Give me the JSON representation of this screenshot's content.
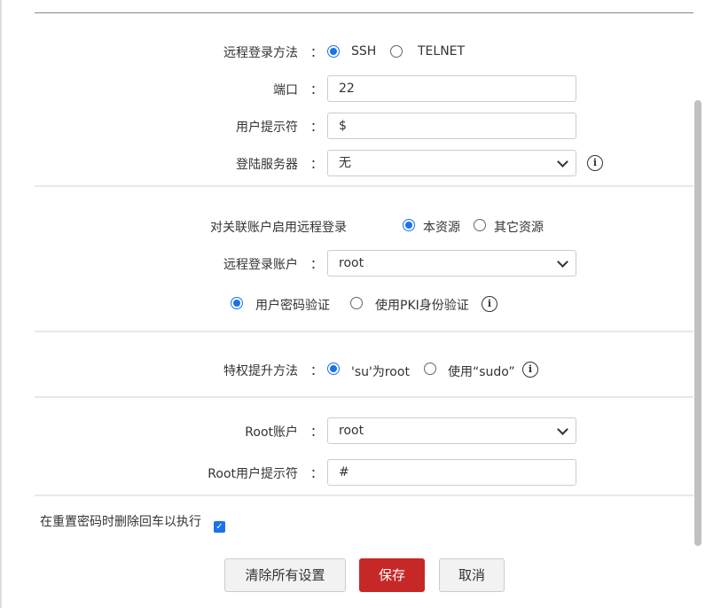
{
  "login_method": {
    "label": "远程登录方法",
    "options": [
      "SSH",
      "TELNET"
    ],
    "selected": "SSH"
  },
  "port": {
    "label": "端口",
    "value": "22"
  },
  "user_prompt": {
    "label": "用户提示符",
    "value": "$"
  },
  "login_server": {
    "label": "登陆服务器",
    "value": "无"
  },
  "linked_account": {
    "label": "对关联账户启用远程登录",
    "options": [
      "本资源",
      "其它资源"
    ],
    "selected": "本资源"
  },
  "remote_account": {
    "label": "远程登录账户",
    "value": "root"
  },
  "auth": {
    "options": [
      "用户密码验证",
      "使用PKI身份验证"
    ],
    "selected": "用户密码验证"
  },
  "privilege": {
    "label": "特权提升方法",
    "options": [
      "'su'为root",
      "使用“sudo”"
    ],
    "selected": "'su'为root"
  },
  "root_account": {
    "label": "Root账户",
    "value": "root"
  },
  "root_prompt": {
    "label": "Root用户提示符",
    "value": "#"
  },
  "remove_cr": {
    "label": "在重置密码时删除回车以执行",
    "checked": true
  },
  "colon": "：",
  "info": "i",
  "buttons": {
    "clear": "清除所有设置",
    "save": "保存",
    "cancel": "取消"
  }
}
